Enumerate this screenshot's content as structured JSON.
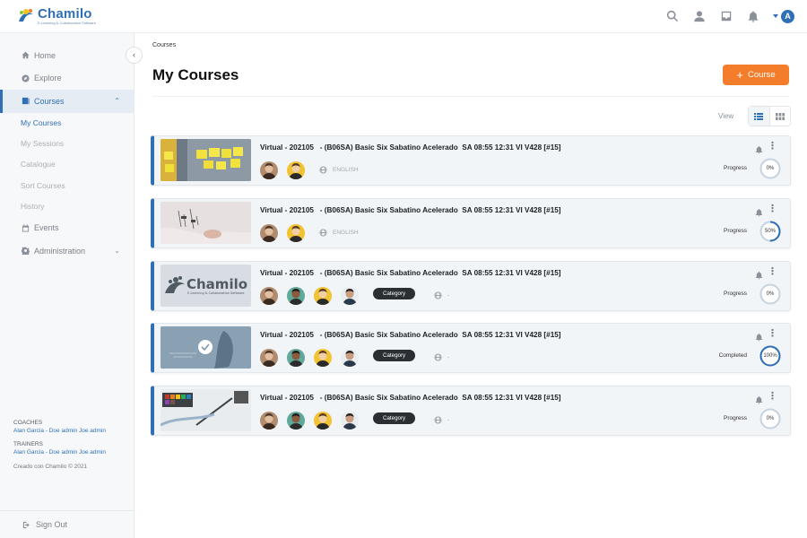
{
  "app": {
    "logo_name": "Chamilo",
    "logo_tagline": "E-Learning & Collaboration Software",
    "avatar_initial": "A",
    "accent": "#2f6fb5",
    "action_color": "#f37d2a"
  },
  "sidebar": {
    "items": [
      {
        "label": "Home",
        "icon": "home-icon"
      },
      {
        "label": "Explore",
        "icon": "compass-icon"
      },
      {
        "label": "Courses",
        "icon": "courses-icon",
        "active": true
      },
      {
        "label": "Events",
        "icon": "calendar-icon"
      },
      {
        "label": "Administration",
        "icon": "gear-icon"
      }
    ],
    "sub_items": [
      {
        "label": "My Courses",
        "active": true
      },
      {
        "label": "My Sessions"
      },
      {
        "label": "Catalogue"
      },
      {
        "label": "Sort Courses"
      },
      {
        "label": "History"
      }
    ],
    "coaches_label": "COACHES",
    "coaches_names": "Alan Garcia - Doe admin Joe admin",
    "trainers_label": "TRAINERS",
    "trainers_names": "Alan Garcia - Doe admin Joe admin",
    "credit": "Creado con Chamilo © 2021",
    "signout": "Sign Out"
  },
  "main": {
    "breadcrumb": "Courses",
    "title": "My Courses",
    "add_button": "Course",
    "view_label": "View"
  },
  "courses": [
    {
      "title": "Virtual - 202105   - (B06SA) Basic Six Sabatino Acelerado  SA 08:55 12:31 VI V428 [#15]",
      "language": "ENGLISH",
      "category": "",
      "progress_label": "Progress",
      "progress": 0,
      "progress_text": "0%"
    },
    {
      "title": "Virtual - 202105   - (B06SA) Basic Six Sabatino Acelerado  SA 08:55 12:31 VI V428 [#15]",
      "language": "ENGLISH",
      "category": "",
      "progress_label": "Progress",
      "progress": 50,
      "progress_text": "50%"
    },
    {
      "title": "Virtual - 202105   - (B06SA) Basic Six Sabatino Acelerado  SA 08:55 12:31 VI V428 [#15]",
      "language": "-",
      "category": "Category",
      "progress_label": "Progress",
      "progress": 0,
      "progress_text": "0%"
    },
    {
      "title": "Virtual - 202105   - (B06SA) Basic Six Sabatino Acelerado  SA 08:55 12:31 VI V428 [#15]",
      "language": "-",
      "category": "Category",
      "progress_label": "Completed",
      "progress": 100,
      "progress_text": "100%"
    },
    {
      "title": "Virtual - 202105   - (B06SA) Basic Six Sabatino Acelerado  SA 08:55 12:31 VI V428 [#15]",
      "language": "-",
      "category": "Category",
      "progress_label": "Progress",
      "progress": 0,
      "progress_text": "0%"
    }
  ]
}
